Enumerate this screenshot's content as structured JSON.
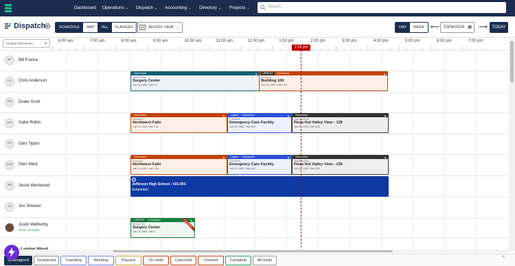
{
  "nav": {
    "items": [
      {
        "label": "Dashboard",
        "dropdown": false
      },
      {
        "label": "Operations",
        "dropdown": true
      },
      {
        "label": "Dispatch",
        "dropdown": true
      },
      {
        "label": "Accounting",
        "dropdown": true
      },
      {
        "label": "Directory",
        "dropdown": true
      },
      {
        "label": "Projects",
        "dropdown": true
      }
    ],
    "search_placeholder": "Search"
  },
  "toolbar": {
    "title": "Dispatch",
    "view_toggle": [
      "SCHEDULE",
      "MAP"
    ],
    "view_selected": "SCHEDULE",
    "filter_toggle": [
      "ALL",
      "FLAGGED"
    ],
    "filter_selected": "ALL",
    "adjust_view": "ADJUST VIEW",
    "range_toggle": [
      "DAY",
      "WEEK"
    ],
    "range_selected": "DAY",
    "date": "10/04/2024",
    "today": "TODAY"
  },
  "filter_techs_placeholder": "FILTER TECHS BY...",
  "hours": [
    "6:00 am",
    "7:00 am",
    "8:00 am",
    "9:00 am",
    "10:00 am",
    "11:00 am",
    "12:00 pm",
    "1:00 pm",
    "2:00 pm",
    "3:00 pm",
    "4:00 pm",
    "5:00 pm",
    "6:00 pm",
    "7:00 pm"
  ],
  "now_label": "1:18 pm",
  "techs": [
    {
      "initials": "BF",
      "name": "Bill France"
    },
    {
      "initials": "CA",
      "name": "Chris Anderson"
    },
    {
      "initials": "DS",
      "name": "Drake Scott"
    },
    {
      "initials": "GR",
      "name": "Gabe Rubin"
    },
    {
      "initials": "GT",
      "name": "Glen Tipton"
    },
    {
      "initials": "GW",
      "name": "Glen West"
    },
    {
      "initials": "JW",
      "name": "Jesse Westwood"
    },
    {
      "initials": "JS",
      "name": "Jon Shearer"
    },
    {
      "initials": "JW",
      "name": "Justin Wetherby",
      "sub": "Work Complete"
    }
  ],
  "jobs": [
    {
      "tags": [
        {
          "text": "Scheduled",
          "color": "#155e75"
        }
      ],
      "type": "Opportunity",
      "name": "Surgery Center",
      "meta": "Job 24-1668, Visit 41",
      "bg": "#eef3f8"
    },
    {
      "tags": [
        {
          "text": "URGENT",
          "color": "#333333"
        },
        {
          "text": "Scheduled",
          "color": "#c2410c"
        }
      ],
      "type": "Warranty",
      "name": "Building 100",
      "meta": "Job 23-1399, Visit 316",
      "bg": "#fdf0e6"
    },
    {
      "tags": [
        {
          "text": "Scheduled",
          "color": "#c2410c"
        }
      ],
      "type": "Warranty",
      "name": "Northwest Falls",
      "meta": "Job 21-1003, Visit 334",
      "bg": "#fdf0e6"
    },
    {
      "tags": [
        {
          "text": "Urgent",
          "color": "#2b4fd6"
        },
        {
          "text": "Scheduled",
          "color": "#2b4fd6"
        }
      ],
      "type": "Call Back",
      "name": "Emergency Care Facility",
      "meta": "Job 22-1685, Visit 442",
      "bg": "#eef0fb"
    },
    {
      "tags": [
        {
          "text": "Scheduled",
          "color": "#333333"
        }
      ],
      "type": "Maintenance",
      "name": "Pizza Hut Valley View - 135",
      "meta": "Job 23-1200, Visit 332",
      "bg": "#eeeeee"
    },
    {
      "tags": [
        {
          "text": "Scheduled",
          "color": "#c2410c"
        }
      ],
      "type": "Warranty",
      "name": "Northwest Falls",
      "meta": "Job 21-1003, Visit 334",
      "bg": "#fdf0e6"
    },
    {
      "tags": [
        {
          "text": "Urgent",
          "color": "#2b4fd6"
        },
        {
          "text": "Scheduled",
          "color": "#2b4fd6"
        }
      ],
      "type": "Call Back",
      "name": "Emergency Care Facility",
      "meta": "Job 22-1685, Visit 442",
      "bg": "#eef0fb"
    },
    {
      "tags": [
        {
          "text": "Scheduled",
          "color": "#333333"
        }
      ],
      "type": "Maintenance",
      "name": "Pizza Hut Valley View - 135",
      "meta": "Job 23-1200, Visit 332",
      "bg": "#eeeeee"
    },
    {
      "tags": [
        {
          "text": "URGENT",
          "color": "#166534"
        },
        {
          "text": "Converted",
          "color": "#15803d"
        }
      ],
      "type": "Break / Fix",
      "name": "Surgery Center",
      "meta": "Job 24-1660, Visit 1",
      "bg": "#eef6f1",
      "corner": "Complete"
    }
  ],
  "big_job": {
    "name": "Jefferson High School - #21-001",
    "status": "Scheduled",
    "color": "#0f39a3"
  },
  "peek_label": "Landon Wood",
  "status_tabs": [
    "Unassigned",
    "Scheduled",
    "Traveling",
    "Working",
    "Paused",
    "On Hold",
    "Canceled",
    "Cleared",
    "Complete",
    "All Visits"
  ],
  "status_selected": "Unassigned",
  "status_colors": [
    "#1b2d4f",
    "#888888",
    "#6b7fd6",
    "#6b7fd6",
    "#c9a227",
    "#c2410c",
    "#c2410c",
    "#c2410c",
    "#1f9d55",
    "#999999"
  ]
}
